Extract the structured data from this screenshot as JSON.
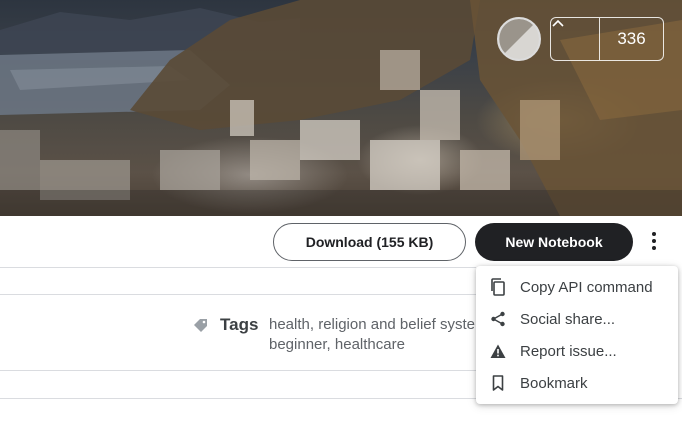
{
  "vote": {
    "count": "336",
    "up_icon": "chevron-up-icon"
  },
  "actions": {
    "download_label": "Download (155 KB)",
    "new_notebook_label": "New Notebook",
    "more_icon": "more-vert-icon"
  },
  "tags": {
    "label": "Tags",
    "line1": "health, religion and belief systems",
    "line2": "beginner, healthcare"
  },
  "menu": {
    "items": [
      {
        "label": "Copy API command",
        "icon": "copy-icon"
      },
      {
        "label": "Social share...",
        "icon": "share-icon"
      },
      {
        "label": "Report issue...",
        "icon": "warning-icon"
      },
      {
        "label": "Bookmark",
        "icon": "bookmark-icon"
      }
    ]
  },
  "colors": {
    "primary_button": "#202124",
    "text": "#202124",
    "muted_text": "#5f6368",
    "divider": "#dadce0"
  }
}
